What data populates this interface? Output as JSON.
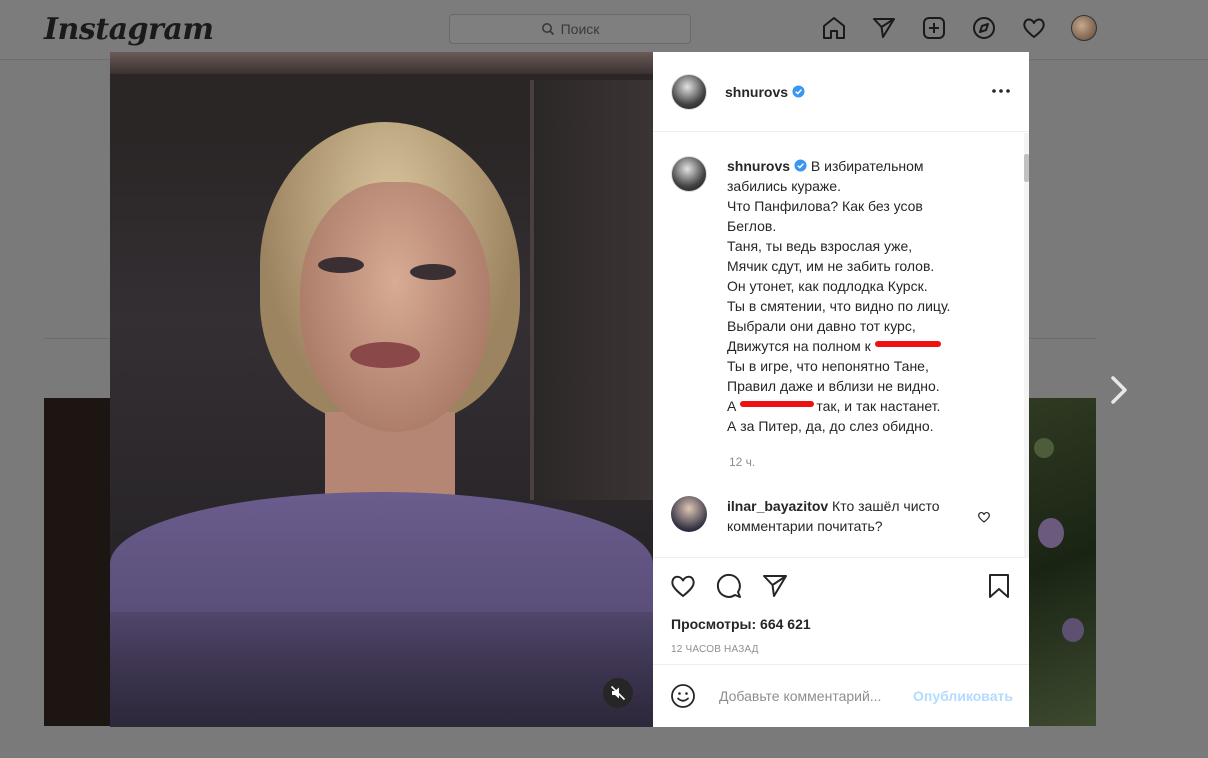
{
  "app": {
    "logo": "Instagram"
  },
  "search": {
    "placeholder": "Поиск"
  },
  "nav": {
    "icons": [
      "home-icon",
      "direct-icon",
      "new-post-icon",
      "explore-icon",
      "activity-heart-icon",
      "profile-avatar"
    ]
  },
  "post": {
    "username": "shnurovs",
    "caption_lines": [
      "В избирательном",
      "забились кураже.",
      "Что Панфилова? Как без усов",
      "Беглов.",
      "Таня, ты ведь взрослая уже,",
      "Мячик сдут, им не забить голов.",
      "Он утонет, как подлодка Курск.",
      "Ты в смятении, что видно по лицу.",
      "Выбрали они давно тот курс,",
      "Движутся на полном к",
      "Ты в игре, что непонятно Тане,",
      "Правил даже и вблизи не видно.",
      "А",
      "так, и так настанет.",
      "А за Питер, да, до слез обидно."
    ],
    "time": "12 ч.",
    "comment": {
      "username": "ilnar_bayazitov",
      "text_line1": "Кто зашёл чисто",
      "text_line2": "комментарии почитать?"
    },
    "views": "Просмотры: 664 621",
    "ago": "12 ЧАСОВ НАЗАД",
    "add_comment_placeholder": "Добавьте комментарий...",
    "publish_label": "Опубликовать"
  },
  "colors": {
    "verified": "#3897f0",
    "redaction": "#ee1111",
    "publish_disabled": "#b3dbff"
  }
}
